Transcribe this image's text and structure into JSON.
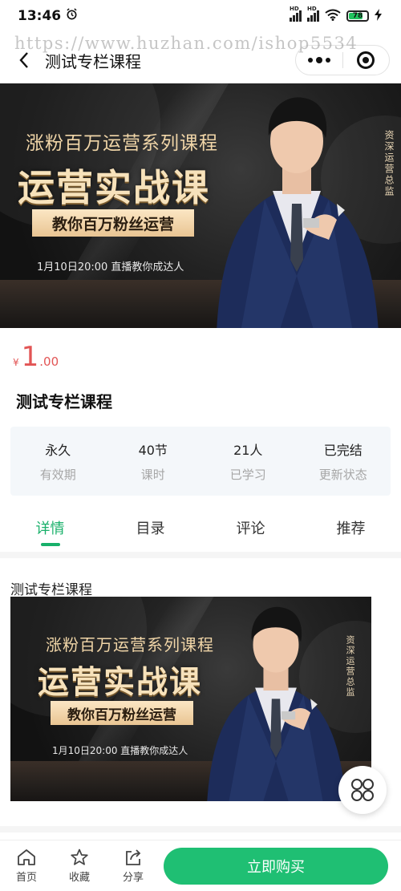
{
  "status_bar": {
    "time": "13:46",
    "battery": "78",
    "battery_level": 0.78
  },
  "watermark": "https://www.huzhan.com/ishop5534",
  "nav": {
    "title": "测试专栏课程"
  },
  "banner": {
    "subtitle": "涨粉百万运营系列课程",
    "headline": "运营实战课",
    "pill": "教你百万粉丝运营",
    "date_text": "1月10日20:00   直播教你成达人",
    "side_text": "资深运营总监"
  },
  "price": {
    "symbol": "¥",
    "integer": "1",
    "decimal": ".00"
  },
  "course": {
    "title": "测试专栏课程"
  },
  "stats": [
    {
      "value": "永久",
      "label": "有效期"
    },
    {
      "value": "40节",
      "label": "课时"
    },
    {
      "value": "21人",
      "label": "已学习"
    },
    {
      "value": "已完结",
      "label": "更新状态"
    }
  ],
  "tabs": [
    {
      "label": "详情",
      "active": true
    },
    {
      "label": "目录",
      "active": false
    },
    {
      "label": "评论",
      "active": false
    },
    {
      "label": "推荐",
      "active": false
    }
  ],
  "content": {
    "title": "测试专栏课程"
  },
  "bottom_bar": {
    "home": "首页",
    "favorite": "收藏",
    "share": "分享",
    "buy": "立即购买"
  },
  "colors": {
    "accent": "#1fbf73",
    "price": "#e25555",
    "banner_gold": "#f7e2bb"
  },
  "icons": [
    "alarm-icon",
    "signal-icon",
    "wifi-icon",
    "battery-icon",
    "back-icon",
    "more-icon",
    "target-icon",
    "grid-icon",
    "home-icon",
    "star-icon",
    "share-icon"
  ]
}
